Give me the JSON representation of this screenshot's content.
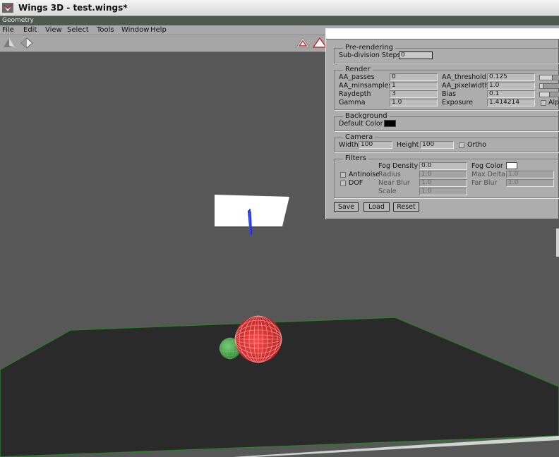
{
  "window": {
    "title": "Wings 3D - test.wings*"
  },
  "geometry_strip": {
    "label": "Geometry"
  },
  "menubar": {
    "items": [
      {
        "label": "File"
      },
      {
        "label": "Edit"
      },
      {
        "label": "View"
      },
      {
        "label": "Select"
      },
      {
        "label": "Tools"
      },
      {
        "label": "Window"
      },
      {
        "label": "Help"
      }
    ]
  },
  "toolbar": {
    "icons": [
      "vertex-mode-icon",
      "edge-mode-icon",
      "face-mode-icon",
      "body-mode-icon"
    ]
  },
  "dialog": {
    "prerendering": {
      "title": "Pre-rendering",
      "subdiv_label": "Sub-division Steps",
      "subdiv_value": "0"
    },
    "render": {
      "title": "Render",
      "aa_passes_label": "AA_passes",
      "aa_passes_value": "0",
      "aa_minsamples_label": "AA_minsamples",
      "aa_minsamples_value": "1",
      "raydepth_label": "Raydepth",
      "raydepth_value": "3",
      "gamma_label": "Gamma",
      "gamma_value": "1.0",
      "aa_threshold_label": "AA_threshold",
      "aa_threshold_value": "0.125",
      "aa_pixelwidth_label": "AA_pixelwidth",
      "aa_pixelwidth_value": "1.0",
      "bias_label": "Bias",
      "bias_value": "0.1",
      "exposure_label": "Exposure",
      "exposure_value": "1.414214",
      "alpha_label": "Alph"
    },
    "background": {
      "title": "Background",
      "default_color_label": "Default Color",
      "default_color": "#000000"
    },
    "camera": {
      "title": "Camera",
      "width_label": "Width",
      "width_value": "100",
      "height_label": "Height",
      "height_value": "100",
      "ortho_label": "Ortho"
    },
    "filters": {
      "title": "Filters",
      "fog_density_label": "Fog Density",
      "fog_density_value": "0.0",
      "fog_color_label": "Fog Color",
      "fog_color": "#ffffff",
      "antinoise_label": "Antinoise",
      "radius_label": "Radius",
      "radius_value": "1.0",
      "max_delta_label": "Max Delta",
      "max_delta_value": "1.0",
      "dof_label": "DOF",
      "near_blur_label": "Near Blur",
      "near_blur_value": "1.0",
      "far_blur_label": "Far Blur",
      "far_blur_value": "1.0",
      "scale_label": "Scale",
      "scale_value": "1.0"
    },
    "buttons": {
      "save": "Save",
      "load": "Load",
      "reset": "Reset"
    }
  },
  "scene": {
    "colors": {
      "background": "#575757",
      "floor": "#2a2a2a",
      "floor_edge": "#2f7a2f",
      "red_sphere": "#d93a3a",
      "green_sphere": "#3c9a3c",
      "plane": "#ffffff",
      "light": "#1a2ad8"
    }
  }
}
